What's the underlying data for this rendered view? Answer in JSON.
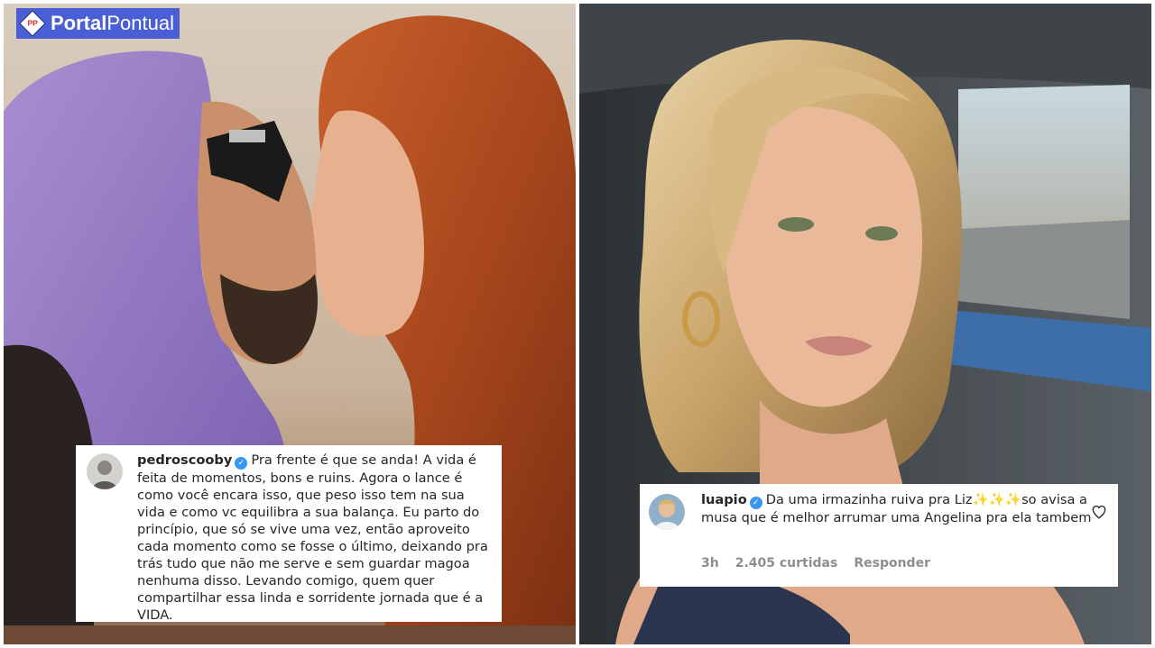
{
  "logo": {
    "text_strong": "Portal",
    "text_light": "Pontual",
    "mark": "PP"
  },
  "left_comment": {
    "username": "pedroscooby",
    "text": "Pra frente é que se anda! A vida é feita de momentos, bons e ruins. Agora o lance é como você encara isso, que peso isso tem na sua vida e como vc equilibra a sua balança. Eu parto do princípio, que só se vive uma vez, então aproveito cada momento como se fosse o último, deixando pra trás tudo que não me serve e sem guardar magoa nenhuma disso. Levando comigo, quem quer compartilhar essa linda e sorridente jornada que é a VIDA."
  },
  "right_comment": {
    "username": "luapio",
    "text": "Da uma irmazinha ruiva pra Liz✨✨✨so avisa a musa que é melhor arrumar uma Angelina pra ela tambem",
    "time": "3h",
    "likes": "2.405 curtidas",
    "reply": "Responder"
  },
  "icons": {
    "verified": "verified-badge-icon",
    "like": "heart-icon"
  },
  "colors": {
    "logo_bg": "#4a5fd6",
    "verified": "#3897f0",
    "meta_text": "#8e8e8e"
  }
}
